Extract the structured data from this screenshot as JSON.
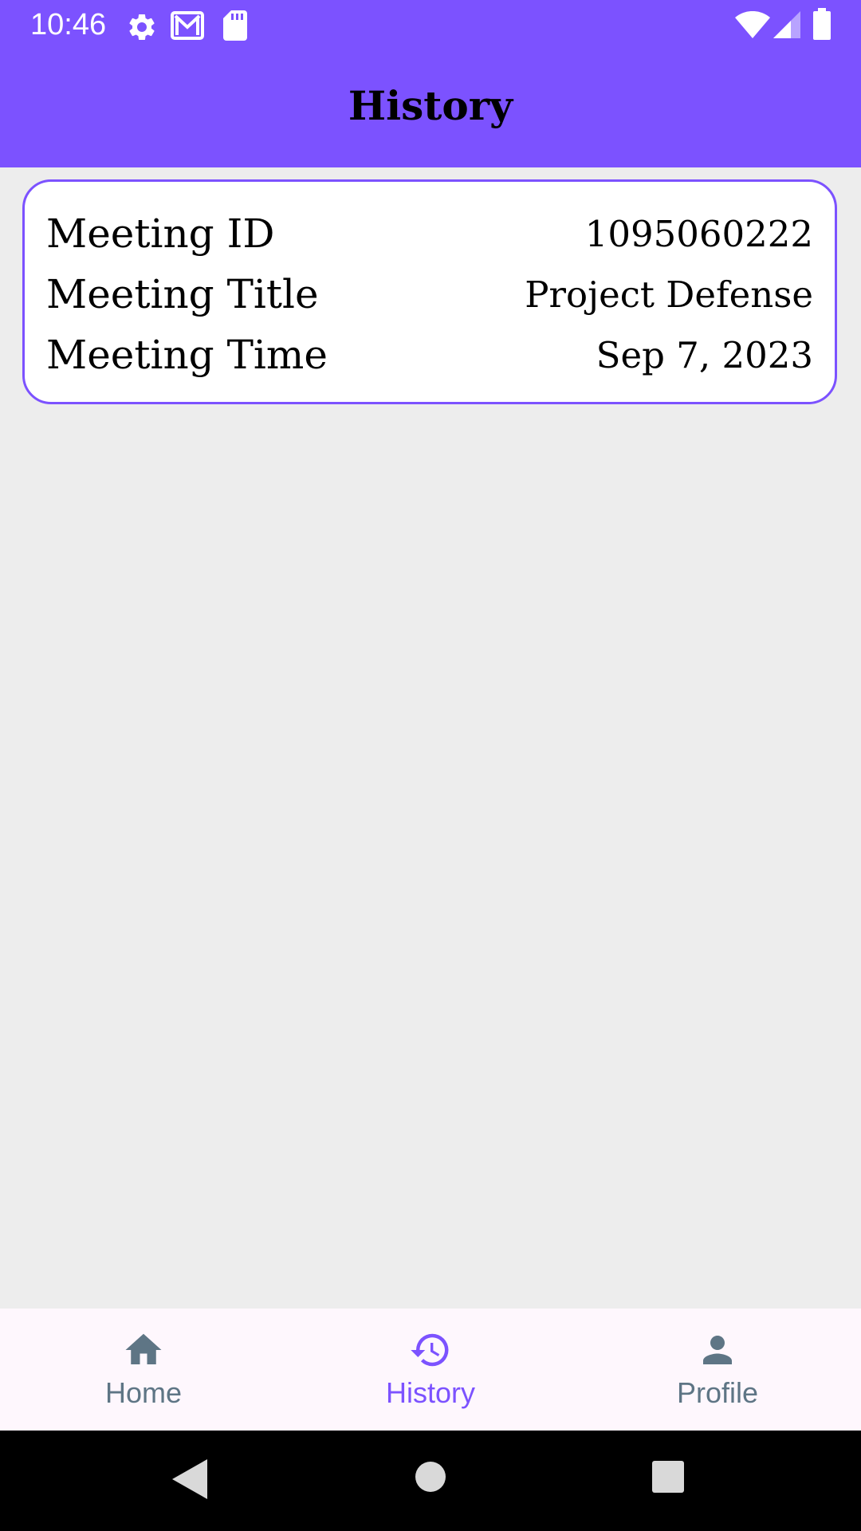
{
  "status_bar": {
    "time": "10:46",
    "icons": [
      "settings-icon",
      "gmail-icon",
      "sd-card-icon",
      "wifi-icon",
      "signal-icon",
      "battery-icon"
    ],
    "color": "#7C52FF"
  },
  "app_bar": {
    "title": "History"
  },
  "meeting_card": {
    "rows": [
      {
        "label": "Meeting ID",
        "value": "1095060222"
      },
      {
        "label": "Meeting Title",
        "value": "Project Defense"
      },
      {
        "label": "Meeting Time",
        "value": "Sep 7, 2023"
      }
    ],
    "border_color": "#7C52FF"
  },
  "bottom_nav": {
    "items": [
      {
        "label": "Home",
        "icon": "home-icon",
        "active": false
      },
      {
        "label": "History",
        "icon": "history-icon",
        "active": true
      },
      {
        "label": "Profile",
        "icon": "person-icon",
        "active": false
      }
    ],
    "active_color": "#7C52FF",
    "inactive_color": "#5E7585"
  },
  "system_nav": {
    "buttons": [
      "back-icon",
      "home-circle-icon",
      "recents-icon"
    ]
  }
}
